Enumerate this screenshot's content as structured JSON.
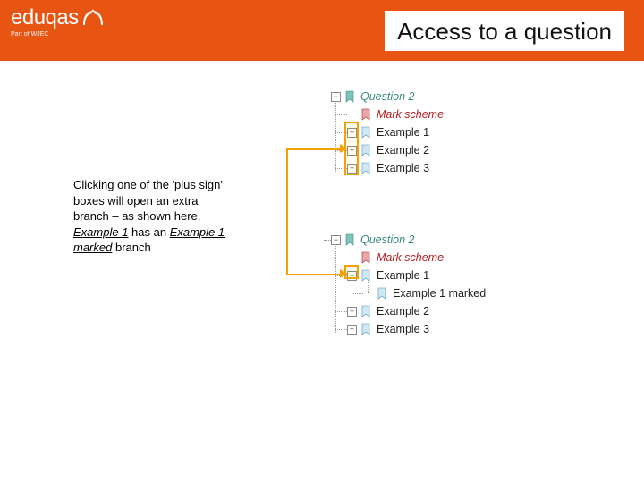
{
  "header": {
    "logo_text": "eduqas",
    "logo_sub": "Part of WJEC",
    "title": "Access to a question"
  },
  "callout": {
    "text_pre": "Clicking one of the 'plus sign' boxes will open an extra branch – as shown here, ",
    "em1": "Example 1",
    "text_mid": " has an ",
    "em2": "Example 1 marked",
    "text_post": " branch"
  },
  "tree_top": {
    "question": "Question 2",
    "mark_scheme": "Mark scheme",
    "examples": [
      "Example 1",
      "Example 2",
      "Example 3"
    ]
  },
  "tree_bottom": {
    "question": "Question 2",
    "mark_scheme": "Mark scheme",
    "example1": "Example 1",
    "example1_marked": "Example 1 marked",
    "example2": "Example 2",
    "example3": "Example 3"
  },
  "glyphs": {
    "plus": "+",
    "minus": "−"
  }
}
